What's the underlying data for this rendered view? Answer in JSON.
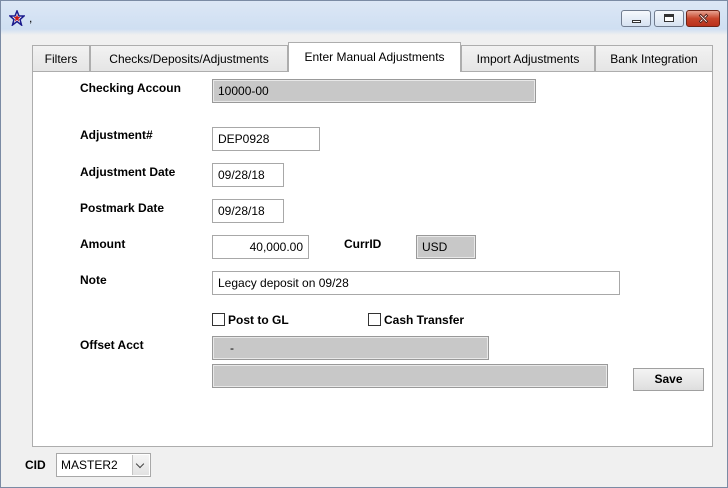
{
  "window": {
    "title": ","
  },
  "tabs": [
    {
      "label": "Filters"
    },
    {
      "label": "Checks/Deposits/Adjustments"
    },
    {
      "label": "Enter Manual Adjustments"
    },
    {
      "label": "Import Adjustments"
    },
    {
      "label": "Bank Integration"
    }
  ],
  "form": {
    "checking_account": {
      "label": "Checking Accoun",
      "value": "10000-00"
    },
    "adjustment_number": {
      "label": "Adjustment#",
      "value": "DEP0928"
    },
    "adjustment_date": {
      "label": "Adjustment Date",
      "value": "09/28/18"
    },
    "postmark_date": {
      "label": "Postmark Date",
      "value": "09/28/18"
    },
    "amount": {
      "label": "Amount",
      "value": "40,000.00"
    },
    "curr_id": {
      "label": "CurrID",
      "value": "USD"
    },
    "note": {
      "label": "Note",
      "value": "Legacy deposit on 09/28"
    },
    "post_to_gl": {
      "label": "Post to GL",
      "checked": false
    },
    "cash_transfer": {
      "label": "Cash Transfer",
      "checked": false
    },
    "offset_acct": {
      "label": "Offset Acct",
      "value": "-",
      "description": ""
    },
    "save_label": "Save"
  },
  "footer": {
    "cid_label": "CID",
    "cid_value": "MASTER2"
  },
  "colors": {
    "readonly_bg": "#c8c8c8",
    "panel_bg": "#ffffff",
    "window_bg": "#f0f0f0"
  }
}
